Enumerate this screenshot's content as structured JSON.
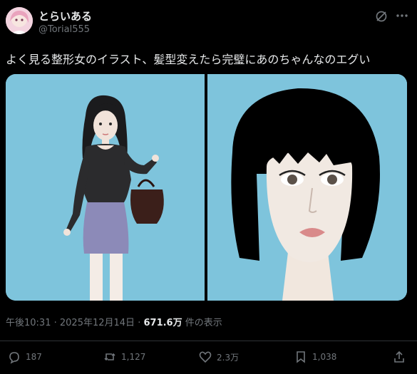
{
  "author": {
    "display_name": "とらいある",
    "handle": "@Torial555"
  },
  "post": {
    "text": "よく見る整形女のイラスト、髪型変えたら完璧にあのちゃんなのエグい",
    "time": "午後10:31",
    "sep": "·",
    "date": "2025年12月14日",
    "views_count": "671.6万",
    "views_label": "件の表示"
  },
  "media": {
    "left_alt": "illustration-woman-long-hair",
    "right_alt": "illustration-woman-bob-hair-closeup",
    "background_color": "#7ec4dc"
  },
  "actions": {
    "replies": "187",
    "reposts": "1,127",
    "likes": "2.3万",
    "bookmarks": "1,038"
  },
  "icons": {
    "grok": "grok-icon",
    "more": "more-icon",
    "reply": "reply-icon",
    "repost": "repost-icon",
    "like": "like-icon",
    "bookmark": "bookmark-icon",
    "share": "share-icon"
  },
  "colors": {
    "background": "#000000",
    "text_primary": "#e7e9ea",
    "text_secondary": "#71767b"
  }
}
